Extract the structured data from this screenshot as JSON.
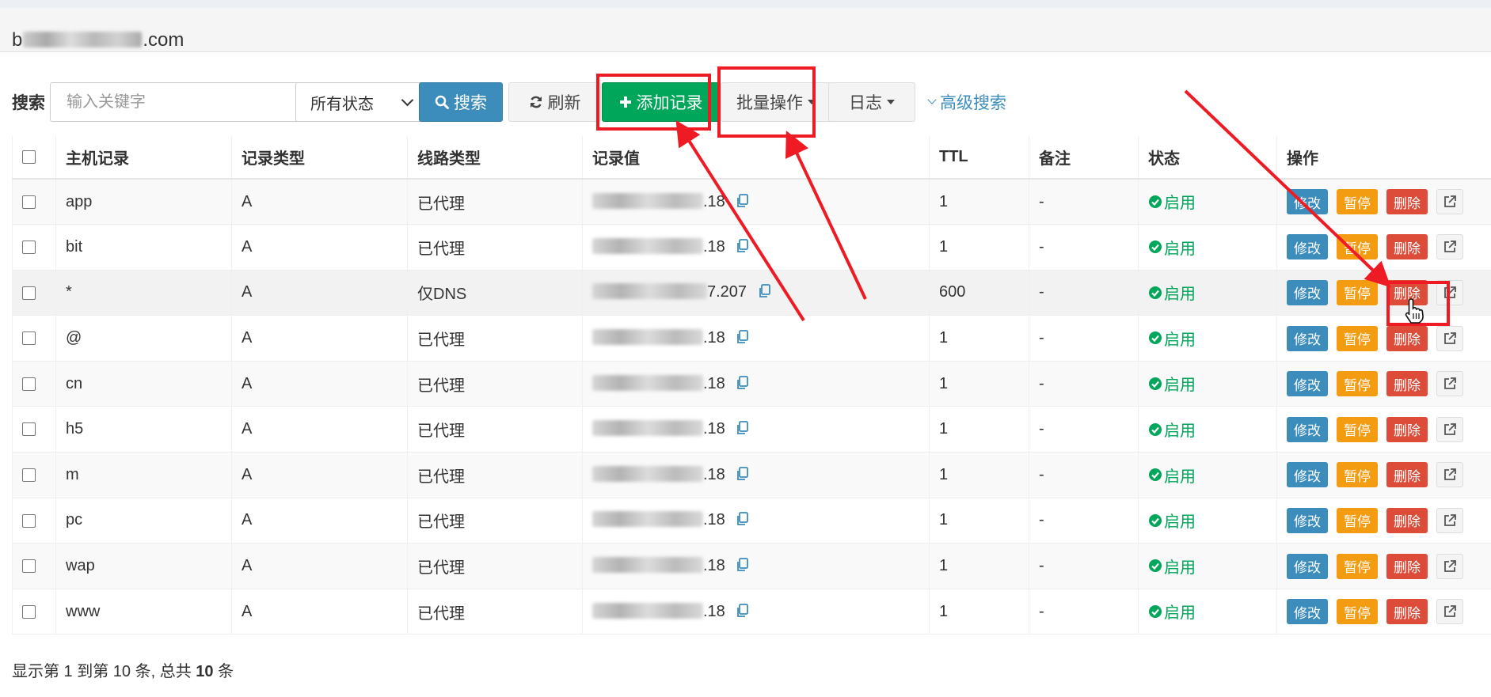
{
  "domain": {
    "prefix": "b",
    "suffix": ".com"
  },
  "toolbar": {
    "search_label": "搜索",
    "search_placeholder": "输入关键字",
    "status_select_value": "所有状态",
    "search_button": "搜索",
    "refresh_button": "刷新",
    "add_button": "添加记录",
    "batch_button": "批量操作",
    "log_button": "日志",
    "advanced_link": "高级搜索"
  },
  "table": {
    "headers": {
      "host": "主机记录",
      "type": "记录类型",
      "line": "线路类型",
      "value": "记录值",
      "ttl": "TTL",
      "remark": "备注",
      "status": "状态",
      "action": "操作"
    },
    "rows": [
      {
        "host": "app",
        "type": "A",
        "line": "已代理",
        "value_suffix": ".18",
        "ttl": "1",
        "remark": "-",
        "status": "启用"
      },
      {
        "host": "bit",
        "type": "A",
        "line": "已代理",
        "value_suffix": ".18",
        "ttl": "1",
        "remark": "-",
        "status": "启用"
      },
      {
        "host": "*",
        "type": "A",
        "line": "仅DNS",
        "value_suffix": "7.207",
        "ttl": "600",
        "remark": "-",
        "status": "启用"
      },
      {
        "host": "@",
        "type": "A",
        "line": "已代理",
        "value_suffix": ".18",
        "ttl": "1",
        "remark": "-",
        "status": "启用"
      },
      {
        "host": "cn",
        "type": "A",
        "line": "已代理",
        "value_suffix": ".18",
        "ttl": "1",
        "remark": "-",
        "status": "启用"
      },
      {
        "host": "h5",
        "type": "A",
        "line": "已代理",
        "value_suffix": ".18",
        "ttl": "1",
        "remark": "-",
        "status": "启用"
      },
      {
        "host": "m",
        "type": "A",
        "line": "已代理",
        "value_suffix": ".18",
        "ttl": "1",
        "remark": "-",
        "status": "启用"
      },
      {
        "host": "pc",
        "type": "A",
        "line": "已代理",
        "value_suffix": ".18",
        "ttl": "1",
        "remark": "-",
        "status": "启用"
      },
      {
        "host": "wap",
        "type": "A",
        "line": "已代理",
        "value_suffix": ".18",
        "ttl": "1",
        "remark": "-",
        "status": "启用"
      },
      {
        "host": "www",
        "type": "A",
        "line": "已代理",
        "value_suffix": ".18",
        "ttl": "1",
        "remark": "-",
        "status": "启用"
      }
    ],
    "actions": {
      "edit": "修改",
      "pause": "暂停",
      "delete": "删除"
    }
  },
  "footer": {
    "prefix": "显示第 1 到第 10 条, 总共 ",
    "total": "10",
    "suffix": " 条"
  },
  "colors": {
    "primary": "#3c8dbc",
    "success": "#00a65a",
    "warning": "#f39c12",
    "danger": "#dd4b39",
    "annotation": "#ee1b24"
  }
}
